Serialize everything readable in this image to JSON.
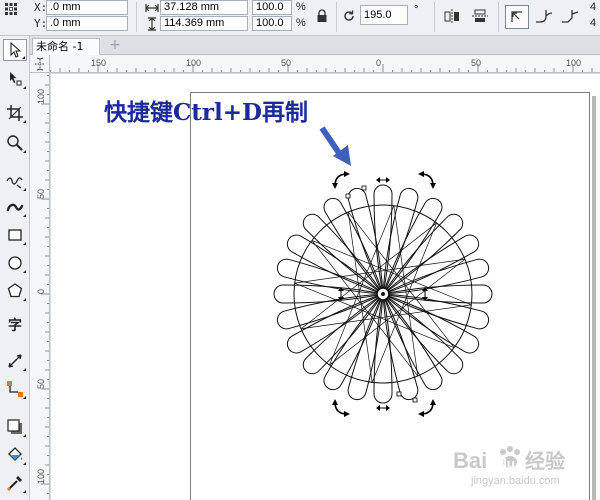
{
  "property_bar": {
    "x_label": "X:",
    "x_value": ".0 mm",
    "y_label": "Y:",
    "y_value": ".0 mm",
    "width_value": "37.128 mm",
    "height_value": "114.369 mm",
    "scale_x": "100.0",
    "scale_y": "100.0",
    "percent_symbol": "%",
    "rotation_value": "195.0",
    "degree_symbol": "°",
    "overflow_value_1": "4",
    "overflow_value_2": "4"
  },
  "tabs": {
    "document_title": "未命名 -1",
    "new_tab_symbol": "+"
  },
  "toolbox": {
    "text_tool_glyph": "字"
  },
  "rulers": {
    "horizontal_labels": [
      "150",
      "100",
      "50",
      "0",
      "50",
      "100"
    ],
    "vertical_labels": [
      "100",
      "50",
      "0",
      "50",
      "100"
    ]
  },
  "canvas": {
    "caption": "快捷键Ctrl+D再制"
  },
  "watermark": {
    "text_bai": "Bai",
    "text_du": "du",
    "text_jingyan": "经验",
    "url": "jingyan.baidu.com"
  },
  "colors": {
    "caption": "#1c2a9e",
    "arrow": "#3f5fbf",
    "watermark": "#c9c9c9"
  }
}
